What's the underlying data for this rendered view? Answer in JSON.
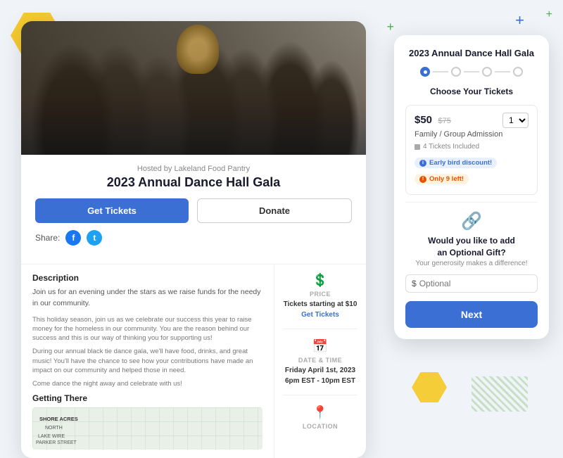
{
  "decorations": {
    "colors": {
      "primary": "#3b6fd4",
      "accent_yellow": "#f5c518",
      "accent_green": "#4caf50",
      "accent_orange": "#e65100"
    }
  },
  "event": {
    "hosted_by": "Hosted by Lakeland Food Pantry",
    "title": "2023 Annual Dance Hall Gala",
    "get_tickets_label": "Get Tickets",
    "donate_label": "Donate",
    "share_label": "Share:",
    "description_title": "Description",
    "description_1": "Join us for an evening under the stars as we raise funds for the needy in our community.",
    "description_2": "This holiday season, join us as we celebrate our success this year to raise money for the homeless in our community. You are the reason behind our success and this is our way of thinking you for supporting us!",
    "description_3": "During our annual black tie dance gala, we'll have food, drinks, and great music! You'll have the chance to see how your contributions have made an impact on our community and helped those in need.",
    "description_4": "Come dance the night away and celebrate with us!",
    "getting_there_title": "Getting There",
    "map_label1": "SHORE ACRES",
    "map_label2": "NORTH",
    "map_label3": "LAKE WIRE",
    "map_label4": "PARKER STREET",
    "price_label": "PRICE",
    "price_value": "Tickets starting at $10",
    "price_link": "Get Tickets",
    "date_label": "DATE & TIME",
    "date_value": "Friday April 1st, 2023",
    "time_value": "6pm EST - 10pm EST",
    "location_label": "LOCATION"
  },
  "ticket_panel": {
    "title": "2023 Annual Dance Hall Gala",
    "section_title": "Choose Your Tickets",
    "steps": [
      {
        "active": true
      },
      {
        "active": false
      },
      {
        "active": false
      },
      {
        "active": false
      }
    ],
    "ticket": {
      "price_new": "$50",
      "price_old": "$75",
      "name": "Family / Group Admission",
      "included": "4 Tickets Included",
      "badge_early": "Early bird discount!",
      "badge_limited": "Only 9 left!",
      "qty_default": "1"
    },
    "gift": {
      "title": "Would you like to add",
      "title2": "an Optional Gift?",
      "subtitle": "Your generosity makes a difference!",
      "input_placeholder": "Optional",
      "dollar_sign": "$"
    },
    "next_button": "Next"
  }
}
